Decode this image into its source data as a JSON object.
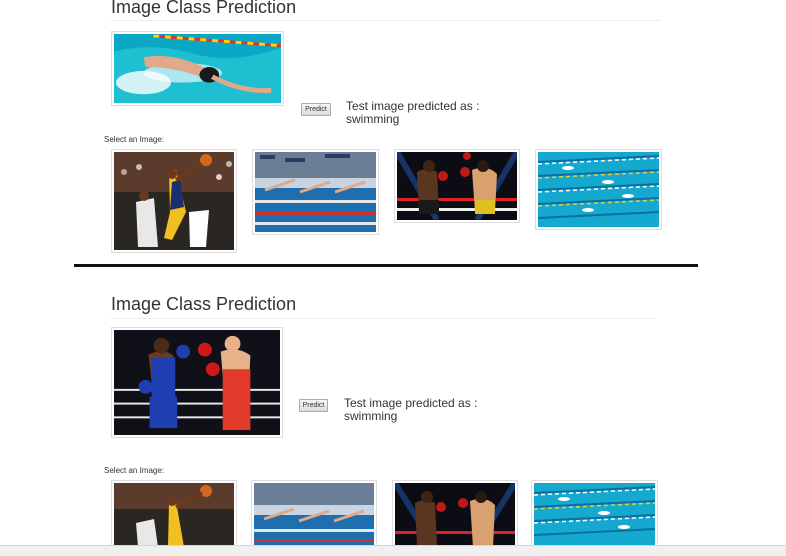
{
  "panels": [
    {
      "title": "Image Class Prediction",
      "selected_image": "swimmer-freestyle-pool-photo",
      "predict_label": "Predict",
      "result_text": "Test image predicted as :",
      "result_class": "swimming",
      "select_label": "Select an Image:",
      "thumbnails": [
        {
          "subject": "basketball-player-dunk-photo"
        },
        {
          "subject": "swimmers-diving-start-photo"
        },
        {
          "subject": "boxing-match-photo"
        },
        {
          "subject": "swimming-pool-lanes-photo"
        }
      ]
    },
    {
      "title": "Image Class Prediction",
      "selected_image": "boxers-red-blue-photo",
      "predict_label": "Predict",
      "result_text": "Test image predicted as :",
      "result_class": "swimming",
      "select_label": "Select an Image:",
      "thumbnails": [
        {
          "subject": "basketball-player-dunk-photo"
        },
        {
          "subject": "swimmers-diving-start-photo"
        },
        {
          "subject": "boxing-match-photo"
        },
        {
          "subject": "swimming-pool-lanes-photo"
        }
      ]
    }
  ]
}
